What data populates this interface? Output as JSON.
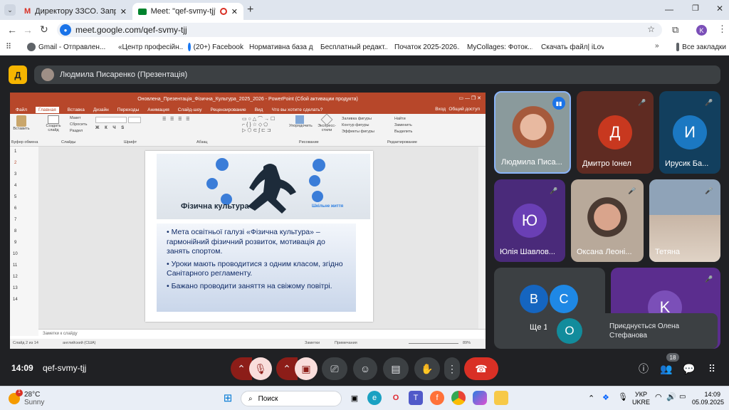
{
  "browser": {
    "tabs": [
      {
        "label": "Директору ЗЗСО. Запрошення"
      },
      {
        "label": "Meet: \"qef-svmy-tjj\""
      }
    ],
    "new_tab": "+",
    "url": "meet.google.com/qef-svmy-tjj",
    "profile_initial": "K",
    "bookmarks": [
      {
        "label": "Gmail - Отправлен..."
      },
      {
        "label": "«Центр професійн..."
      },
      {
        "label": "(20+) Facebook"
      },
      {
        "label": "Нормативна база д..."
      },
      {
        "label": "Бесплатный редакт..."
      },
      {
        "label": "Початок 2025-2026..."
      },
      {
        "label": "MyCollages: Фоток..."
      },
      {
        "label": "Скачать файл| iLov..."
      }
    ],
    "all_bookmarks": "Все закладки"
  },
  "meet": {
    "logo_letter": "Д",
    "presenter_title": "Людмила Писаренко (Презентація)",
    "time": "14:09",
    "meeting_code": "qef-svmy-tjj",
    "people_count": "18",
    "participants": [
      {
        "name": "Людмила Писа...",
        "initial": ""
      },
      {
        "name": "Дмитро Іонел",
        "initial": "Д"
      },
      {
        "name": "Ирусик Ба...",
        "initial": "И"
      },
      {
        "name": "Юлія Шавлов...",
        "initial": "Ю"
      },
      {
        "name": "Оксана Леоні...",
        "initial": ""
      },
      {
        "name": "Тетяна",
        "initial": ""
      }
    ],
    "others_label": "Ще 1",
    "others_avatars": [
      "В",
      "С"
    ],
    "k_tile_initial": "K",
    "join_toast": {
      "initial": "О",
      "text": "Приєднується Олена Стефанова"
    }
  },
  "ppt": {
    "window_title": "Оновлена_Презентація_Фізична_Культура_2025_2026 - PowerPoint (Сбой активации продукта)",
    "menu": [
      "Файл",
      "Главная",
      "Вставка",
      "Дизайн",
      "Переходы",
      "Анимация",
      "Слайд-шоу",
      "Рецензирование",
      "Вид",
      "Что вы хотите сделать?"
    ],
    "menu_right": [
      "Вход",
      "Общий доступ"
    ],
    "ribbon_groups": [
      "Буфер обмена",
      "Слайды",
      "Шрифт",
      "Абзац",
      "Рисование",
      "Редактирование"
    ],
    "ribbon_items": {
      "paste": "Вставить",
      "create_slide": "Создать слайд",
      "layout": "Макет",
      "reset": "Сбросить",
      "section": "Раздел",
      "arrange": "Упорядочить",
      "express_styles": "Экспресс-стили",
      "shape_fill": "Заливка фигуры",
      "shape_outline": "Контур фигуры",
      "shape_effects": "Эффекты фигуры",
      "find": "Найти",
      "replace": "Заменить",
      "select": "Выделить"
    },
    "slide_numbers": [
      "1",
      "2",
      "3",
      "4",
      "5",
      "6",
      "7",
      "8",
      "9",
      "10",
      "11",
      "12",
      "13",
      "14"
    ],
    "slide": {
      "banner_title": "Фізична культура",
      "banner_sub": "Шкільне життя",
      "bullets": [
        "Мета освітньої галузі «Фізична культура» – гармонійний фізичний розвиток, мотивація до занять спортом.",
        "Уроки мають проводитися з одним класом, згідно Санітарного регламенту.",
        "Бажано проводити заняття на свіжому повітрі."
      ]
    },
    "notes_placeholder": "Заметки к слайду",
    "status_left": "Слайд 2 из 14",
    "status_lang": "английский (США)",
    "status_notes": "Заметки",
    "status_comments": "Примечания",
    "zoom": "89%"
  },
  "taskbar": {
    "weather_temp": "28°C",
    "weather_desc": "Sunny",
    "weather_badge": "1",
    "search": "Поиск",
    "lang_top": "УКР",
    "lang_bottom": "UKRE",
    "clock_time": "14:09",
    "clock_date": "05.09.2025"
  }
}
